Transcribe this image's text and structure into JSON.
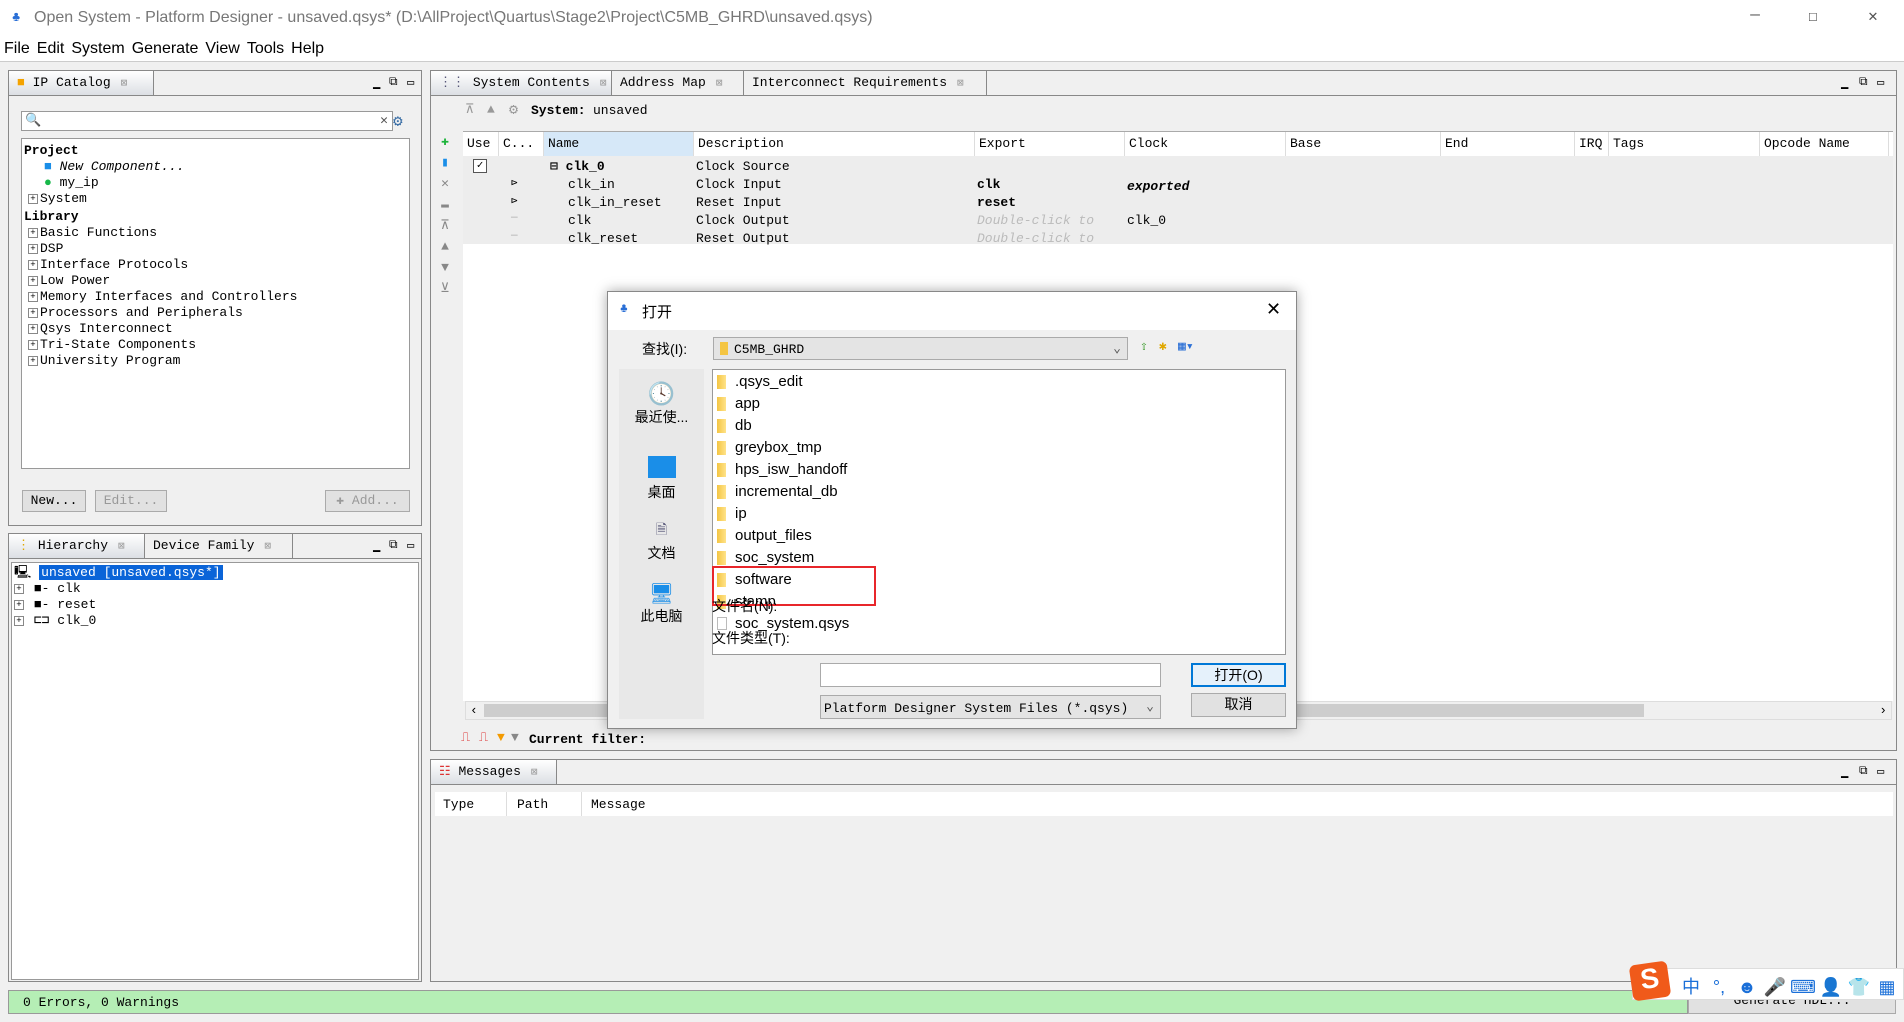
{
  "window": {
    "title": "Open System - Platform Designer - unsaved.qsys* (D:\\AllProject\\Quartus\\Stage2\\Project\\C5MB_GHRD\\unsaved.qsys)",
    "minimize": "—",
    "maximize": "☐",
    "close": "✕"
  },
  "menu": [
    "File",
    "Edit",
    "System",
    "Generate",
    "View",
    "Tools",
    "Help"
  ],
  "ip_catalog": {
    "tab": "IP Catalog",
    "search_placeholder": "",
    "project_label": "Project",
    "new_component": "New Component...",
    "my_ip": "my_ip",
    "system": "System",
    "library_label": "Library",
    "library": [
      "Basic Functions",
      "DSP",
      "Interface Protocols",
      "Low Power",
      "Memory Interfaces and Controllers",
      "Processors and Peripherals",
      "Qsys Interconnect",
      "Tri-State Components",
      "University Program"
    ],
    "new_btn": "New...",
    "edit_btn": "Edit...",
    "add_btn": "Add..."
  },
  "hierarchy": {
    "tabs": [
      "Hierarchy",
      "Device Family"
    ],
    "root": "unsaved [unsaved.qsys*]",
    "items": [
      "clk",
      "reset",
      "clk_0"
    ]
  },
  "system_contents": {
    "tabs": [
      "System Contents",
      "Address Map",
      "Interconnect Requirements"
    ],
    "system_label": "System:",
    "system_name": "unsaved",
    "columns": [
      "Use",
      "C...",
      "Name",
      "Description",
      "Export",
      "Clock",
      "Base",
      "End",
      "IRQ",
      "Tags",
      "Opcode Name"
    ],
    "rows": [
      {
        "use": true,
        "name": "clk_0",
        "description": "Clock Source",
        "export": "",
        "clock": ""
      },
      {
        "name": "clk_in",
        "description": "Clock Input",
        "export": "clk",
        "clock": "exported"
      },
      {
        "name": "clk_in_reset",
        "description": "Reset Input",
        "export": "reset",
        "clock": ""
      },
      {
        "name": "clk",
        "description": "Clock Output",
        "export": "Double-click to",
        "clock": "clk_0"
      },
      {
        "name": "clk_reset",
        "description": "Reset Output",
        "export": "Double-click to",
        "clock": ""
      }
    ],
    "filter_label": "Current filter:"
  },
  "messages": {
    "tab": "Messages",
    "columns": [
      "Type",
      "Path",
      "Message"
    ]
  },
  "status": {
    "text": "0 Errors, 0 Warnings",
    "generate_btn": "Generate HDL..."
  },
  "dialog": {
    "title": "打开",
    "look_in_label": "查找(I):",
    "look_in_value": "C5MB_GHRD",
    "places": [
      "最近使...",
      "桌面",
      "文档",
      "此电脑"
    ],
    "folders": [
      ".qsys_edit",
      "app",
      "db",
      "greybox_tmp",
      "hps_isw_handoff",
      "incremental_db",
      "ip",
      "output_files",
      "soc_system",
      "software",
      "stamp"
    ],
    "files": [
      "soc_system.qsys"
    ],
    "filename_label": "文件名(N):",
    "filename_value": "",
    "filetype_label": "文件类型(T):",
    "filetype_value": "Platform Designer System Files (*.qsys)",
    "open_btn": "打开(O)",
    "cancel_btn": "取消",
    "highlight_color": "#e8262b"
  },
  "ime": {
    "logo": "S",
    "items": [
      "中",
      "°,",
      "☻",
      "🎤",
      "⌨",
      "👤",
      "👕",
      "▦"
    ]
  }
}
